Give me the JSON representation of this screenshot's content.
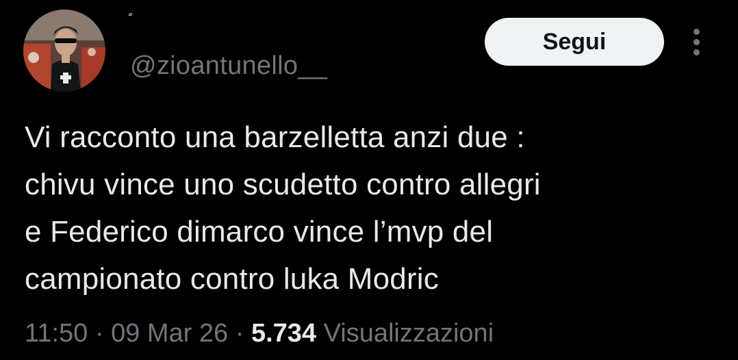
{
  "author": {
    "display_name": "ً",
    "handle": "@zioantunello__"
  },
  "actions": {
    "follow_label": "Segui",
    "more_icon": "more-vertical-icon"
  },
  "tweet": {
    "lines": [
      "Vi racconto una barzelletta anzi due :",
      "chivu vince uno scudetto contro allegri",
      "e Federico dimarco vince l’mvp del",
      "campionato contro luka Modric"
    ]
  },
  "meta": {
    "time": "11:50",
    "separator_1": "·",
    "date": "09 Mar 26",
    "separator_2": "·",
    "views_count": "5.734",
    "views_label": "Visualizzazioni"
  },
  "colors": {
    "background": "#000000",
    "text_primary": "#e7e9ea",
    "text_secondary": "#71767b",
    "button_bg": "#eff3f4",
    "button_text": "#0f1419"
  }
}
